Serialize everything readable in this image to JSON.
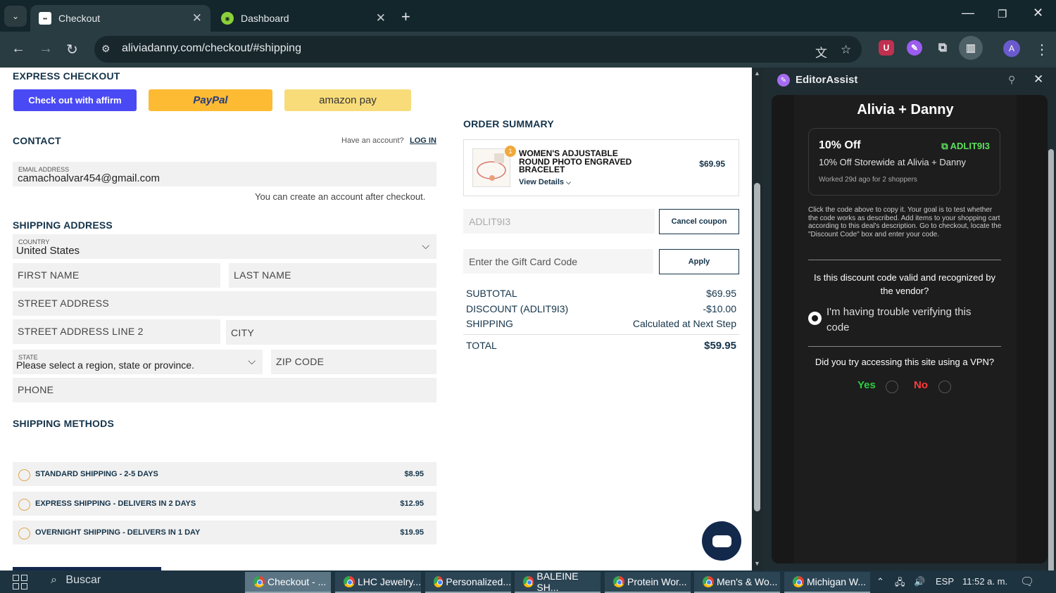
{
  "browser": {
    "tabs": [
      {
        "title": "Checkout",
        "favicon": "store-favicon",
        "active": true
      },
      {
        "title": "Dashboard",
        "favicon": "dashboard-favicon",
        "active": false
      }
    ],
    "url": "aliviadanny.com/checkout/#shipping",
    "profile_initial": "A"
  },
  "express": {
    "title": "EXPRESS CHECKOUT",
    "affirm_label": "Check out with affirm",
    "paypal_label": "PayPal",
    "amazon_label": "amazon pay"
  },
  "contact": {
    "title": "CONTACT",
    "have_account": "Have an account?",
    "login": "LOG IN",
    "email_label": "EMAIL ADDRESS",
    "email_value": "camachoalvar454@gmail.com",
    "create_note": "You can create an account after checkout."
  },
  "shipping_address": {
    "title": "SHIPPING ADDRESS",
    "country_label": "COUNTRY",
    "country_value": "United States",
    "first_name": "FIRST NAME",
    "last_name": "LAST NAME",
    "street": "STREET ADDRESS",
    "street2": "STREET ADDRESS LINE 2",
    "city": "CITY",
    "state_label": "STATE",
    "state_value": "Please select a region, state or province.",
    "zip": "ZIP CODE",
    "phone": "PHONE"
  },
  "shipping_methods": {
    "title": "SHIPPING METHODS",
    "options": [
      {
        "name": "STANDARD SHIPPING - 2-5 DAYS",
        "price": "$8.95"
      },
      {
        "name": "EXPRESS SHIPPING - DELIVERS IN 2 DAYS",
        "price": "$12.95"
      },
      {
        "name": "OVERNIGHT SHIPPING - DELIVERS IN 1 DAY",
        "price": "$19.95"
      }
    ]
  },
  "order": {
    "title": "ORDER SUMMARY",
    "item_qty": "1",
    "item_name": "WOMEN'S ADJUSTABLE ROUND PHOTO ENGRAVED BRACELET",
    "view_details": "View Details",
    "item_price": "$69.95",
    "coupon_value": "ADLIT9I3",
    "cancel_coupon": "Cancel coupon",
    "gift_placeholder": "Enter the Gift Card Code",
    "apply": "Apply",
    "subtotal_label": "SUBTOTAL",
    "subtotal_value": "$69.95",
    "discount_label": "DISCOUNT (ADLIT9I3)",
    "discount_value": "-$10.00",
    "shipping_label": "SHIPPING",
    "shipping_value": "Calculated at Next Step",
    "total_label": "TOTAL",
    "total_value": "$59.95"
  },
  "sidepanel": {
    "title": "EditorAssist",
    "store": "Alivia + Danny",
    "deal_title": "10% Off",
    "deal_code": "ADLIT9I3",
    "deal_desc": "10% Off Storewide at Alivia + Danny",
    "deal_meta": "Worked 29d ago for 2 shoppers",
    "instructions": "Click the code above to copy it. Your goal is to test whether the code works as described. Add items to your shopping cart according to this deal's description. Go to checkout, locate the \"Discount Code\" box and enter your code.",
    "question1": "Is this discount code valid and recognized by the vendor?",
    "option_trouble": "I'm having trouble verifying this code",
    "question2": "Did you try accessing this site using a VPN?",
    "yes": "Yes",
    "no": "No"
  },
  "taskbar": {
    "search": "Buscar",
    "items": [
      "Checkout - ...",
      "LHC Jewelry...",
      "Personalized...",
      "BALEINE SH...",
      "Protein Wor...",
      "Men's & Wo...",
      "Michigan W..."
    ],
    "lang": "ESP",
    "time": "11:52 a. m."
  },
  "colors": {
    "navy": "#15344a",
    "affirm": "#4a4af4",
    "paypal": "#fcbb32",
    "amazon": "#f8dc7a",
    "code_green": "#5ce05c",
    "yes_green": "#2ecc40",
    "no_red": "#ff3b3b"
  }
}
